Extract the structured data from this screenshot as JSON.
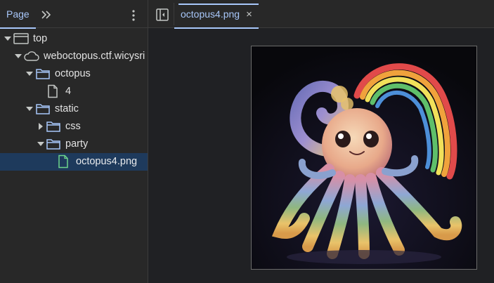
{
  "left_panel": {
    "tab_label": "Page",
    "tree": [
      {
        "label": "top",
        "icon": "frame-icon",
        "expanded": true
      },
      {
        "label": "weboctopus.ctf.wicysri",
        "icon": "cloud-icon",
        "expanded": true
      },
      {
        "label": "octopus",
        "icon": "folder-icon",
        "expanded": true
      },
      {
        "label": "4",
        "icon": "file-icon"
      },
      {
        "label": "static",
        "icon": "folder-icon",
        "expanded": true
      },
      {
        "label": "css",
        "icon": "folder-icon",
        "expanded": false
      },
      {
        "label": "party",
        "icon": "folder-icon",
        "expanded": true
      },
      {
        "label": "octopus4.png",
        "icon": "image-file-icon",
        "selected": true
      }
    ]
  },
  "editor": {
    "open_tab": "octopus4.png",
    "close_symbol": "×",
    "preview_alt": "octopus image"
  },
  "colors": {
    "accent": "#a8c7fa",
    "folder": "#a8c7fa",
    "image_file": "#6dd58c",
    "selected_row": "#1e3a5c"
  }
}
